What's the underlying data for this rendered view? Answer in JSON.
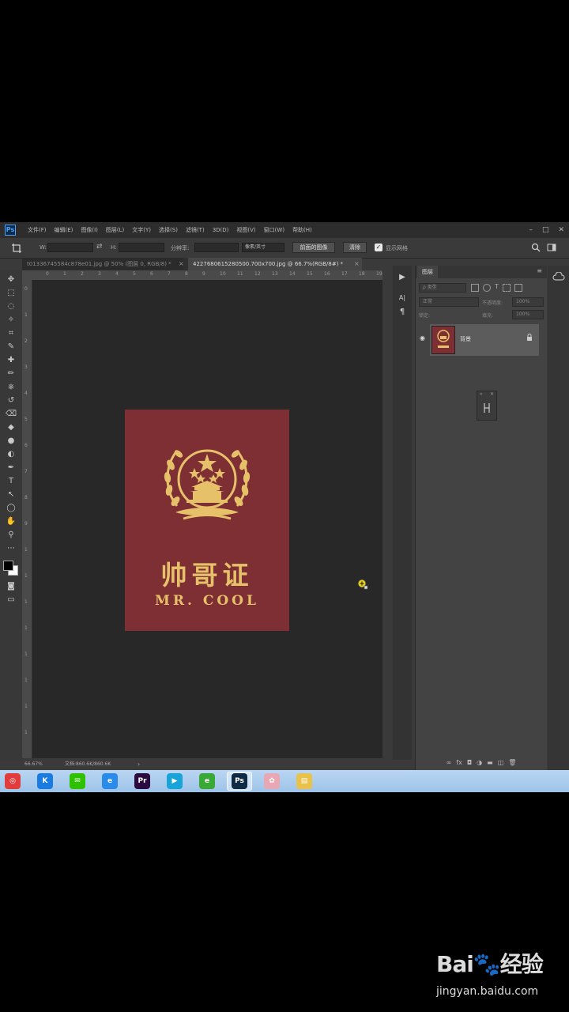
{
  "menubar": {
    "items": [
      "文件(F)",
      "编辑(E)",
      "图像(I)",
      "图层(L)",
      "文字(Y)",
      "选择(S)",
      "滤镜(T)",
      "3D(D)",
      "视图(V)",
      "窗口(W)",
      "帮助(H)"
    ],
    "logo": "Ps",
    "win_controls": [
      "–",
      "□",
      "✕"
    ]
  },
  "options": {
    "w_label": "W:",
    "h_label": "H:",
    "resolution_label": "分辨率:",
    "unit_value": "像素/英寸",
    "front_image_button": "前面的图像",
    "clear_button": "清除",
    "delete_cropped_label": "显示网格"
  },
  "tabs": [
    {
      "label": "t01336745584c878e01.jpg @ 50% (图层 0, RGB/8) *",
      "close": "×"
    },
    {
      "label": "4227680615280500.700x700.jpg @ 66.7%(RGB/8#) *",
      "close": "×"
    }
  ],
  "ruler": {
    "top": [
      "0",
      "1",
      "2",
      "3",
      "4",
      "5",
      "6",
      "7",
      "8",
      "9",
      "10",
      "11",
      "12",
      "13",
      "14",
      "15",
      "16",
      "17",
      "18",
      "19"
    ],
    "left": [
      "0",
      "1",
      "2",
      "3",
      "4",
      "5",
      "6",
      "7",
      "8",
      "9",
      "1",
      "1",
      "1",
      "1",
      "1",
      "1",
      "1",
      "1"
    ]
  },
  "tools": [
    "move-tool",
    "marquee-tool",
    "lasso-tool",
    "magic-wand-tool",
    "crop-tool",
    "eyedropper-tool",
    "healing-tool",
    "brush-tool",
    "stamp-tool",
    "history-brush-tool",
    "eraser-tool",
    "paint-bucket-tool",
    "blur-tool",
    "dodge-tool",
    "pen-tool",
    "type-tool",
    "path-select-tool",
    "shape-tool",
    "hand-tool",
    "zoom-tool",
    "more-tools"
  ],
  "document": {
    "title": "帅哥证",
    "subtitle": "MR. COOL",
    "colors": {
      "cover": "#7d2f34",
      "gold": "#e7c169"
    }
  },
  "status": {
    "zoom": "66.67%",
    "doc_info": "文档:860.6K/860.6K",
    "arrow": "›"
  },
  "mid_strip": {
    "icons": [
      "play-icon",
      "character-icon",
      "paragraph-icon"
    ],
    "char_glyph": "A|",
    "para_glyph": "¶",
    "play_glyph": "▶"
  },
  "layers_panel": {
    "tab": "图层",
    "search_placeholder": "ρ 类型",
    "blend_mode": "正常",
    "opacity_label": "不透明度:",
    "opacity_value": "100%",
    "lock_label": "锁定:",
    "fill_label": "填充:",
    "fill_value": "100%",
    "layer_name": "背景",
    "eye": "◉",
    "lock_glyph": "🔒",
    "bottom_icons": [
      "∞",
      "fx",
      "◘",
      "◑",
      "▬",
      "◫",
      "🗑"
    ]
  },
  "taskbar": {
    "apps": [
      {
        "name": "netease-music",
        "glyph": "◎",
        "bg": "#e23b3b"
      },
      {
        "name": "kugou",
        "glyph": "K",
        "bg": "#1a7be0"
      },
      {
        "name": "wechat",
        "glyph": "✉",
        "bg": "#2dc100"
      },
      {
        "name": "ie",
        "glyph": "e",
        "bg": "#2a8be8"
      },
      {
        "name": "premiere",
        "glyph": "Pr",
        "bg": "#2b0b3f"
      },
      {
        "name": "player",
        "glyph": "▶",
        "bg": "#18a4d8"
      },
      {
        "name": "browser",
        "glyph": "e",
        "bg": "#3aa835"
      },
      {
        "name": "photoshop",
        "glyph": "Ps",
        "bg": "#0f2a44"
      },
      {
        "name": "paint",
        "glyph": "✿",
        "bg": "#e9a7b4"
      },
      {
        "name": "folder",
        "glyph": "▤",
        "bg": "#e8c24a"
      }
    ]
  },
  "watermark": {
    "logo": "Bai🐾经验",
    "url": "jingyan.baidu.com"
  }
}
